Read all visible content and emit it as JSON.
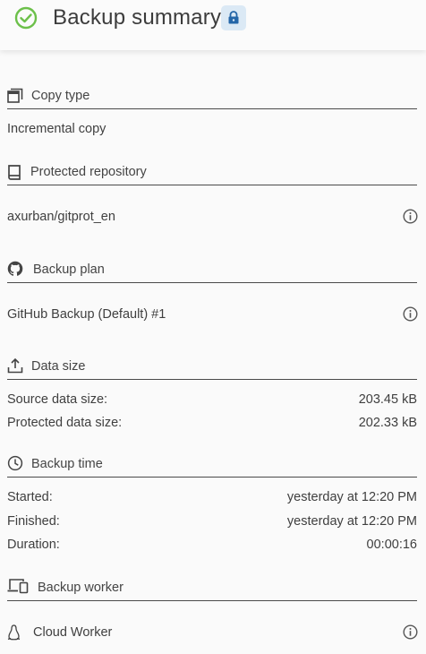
{
  "header": {
    "title": "Backup summary",
    "status_icon": "check-circle-icon",
    "lock_icon": "lock-icon",
    "status_color": "#6cc04a",
    "lock_color": "#2466a8"
  },
  "copy_type": {
    "label": "Copy type",
    "value": "Incremental copy"
  },
  "repository": {
    "label": "Protected repository",
    "value": "axurban/gitprot_en"
  },
  "plan": {
    "label": "Backup plan",
    "value": "GitHub Backup (Default) #1"
  },
  "data_size": {
    "label": "Data size",
    "rows": [
      {
        "key": "Source data size:",
        "value": "203.45 kB"
      },
      {
        "key": "Protected data size:",
        "value": "202.33 kB"
      }
    ]
  },
  "time": {
    "label": "Backup time",
    "rows": [
      {
        "key": "Started:",
        "value": "yesterday at 12:20 PM"
      },
      {
        "key": "Finished:",
        "value": "yesterday at 12:20 PM"
      },
      {
        "key": "Duration:",
        "value": "00:00:16"
      }
    ]
  },
  "worker": {
    "label": "Backup worker",
    "value": "Cloud Worker"
  }
}
